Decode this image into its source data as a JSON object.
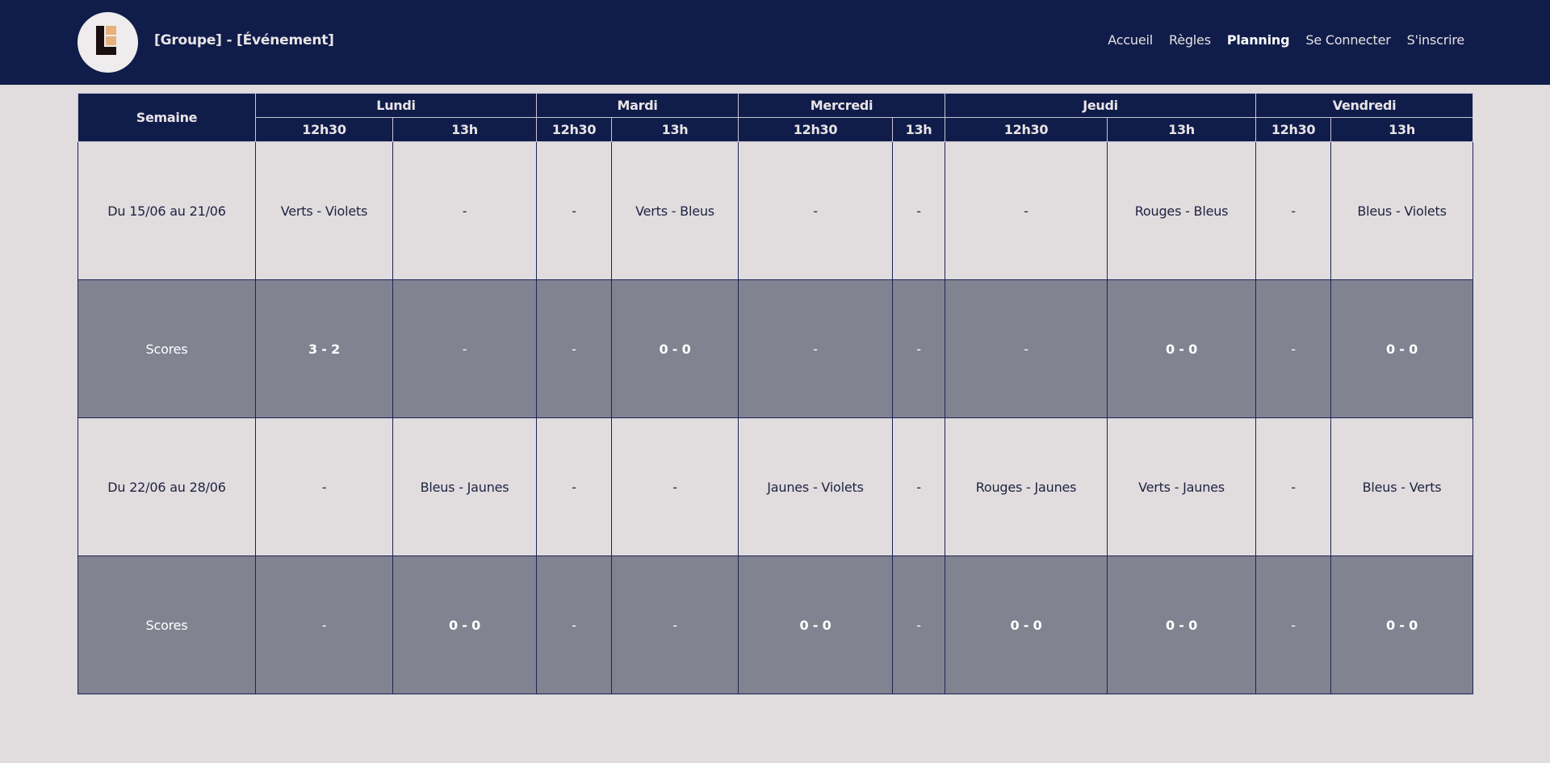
{
  "header": {
    "title": "[Groupe] - [Événement]",
    "nav": [
      "Accueil",
      "Règles",
      "Planning",
      "Se Connecter",
      "S'inscrire"
    ],
    "active": "Planning",
    "colors": {
      "bar": "#101d4a",
      "page": "#e1dcde",
      "score_row": "#828391",
      "logo_accent": "#e7b07c"
    }
  },
  "table": {
    "week_header": "Semaine",
    "days": [
      {
        "name": "Lundi",
        "slots": [
          "12h30",
          "13h"
        ]
      },
      {
        "name": "Mardi",
        "slots": [
          "12h30",
          "13h"
        ]
      },
      {
        "name": "Mercredi",
        "slots": [
          "12h30",
          "13h"
        ]
      },
      {
        "name": "Jeudi",
        "slots": [
          "12h30",
          "13h"
        ]
      },
      {
        "name": "Vendredi",
        "slots": [
          "12h30",
          "13h"
        ]
      }
    ],
    "rows": [
      {
        "type": "match",
        "label": "Du 15/06 au 21/06",
        "cells": [
          "Verts - Violets",
          "-",
          "-",
          "Verts - Bleus",
          "-",
          "-",
          "-",
          "Rouges - Bleus",
          "-",
          "Bleus - Violets"
        ]
      },
      {
        "type": "scores",
        "label": "Scores",
        "cells": [
          "3 - 2",
          "-",
          "-",
          "0 - 0",
          "-",
          "-",
          "-",
          "0 - 0",
          "-",
          "0 - 0"
        ]
      },
      {
        "type": "match",
        "label": "Du 22/06 au 28/06",
        "cells": [
          "-",
          "Bleus - Jaunes",
          "-",
          "-",
          "Jaunes - Violets",
          "-",
          "Rouges - Jaunes",
          "Verts - Jaunes",
          "-",
          "Bleus - Verts"
        ]
      },
      {
        "type": "scores",
        "label": "Scores",
        "cells": [
          "-",
          "0 - 0",
          "-",
          "-",
          "0 - 0",
          "-",
          "0 - 0",
          "0 - 0",
          "-",
          "0 - 0"
        ]
      }
    ]
  }
}
